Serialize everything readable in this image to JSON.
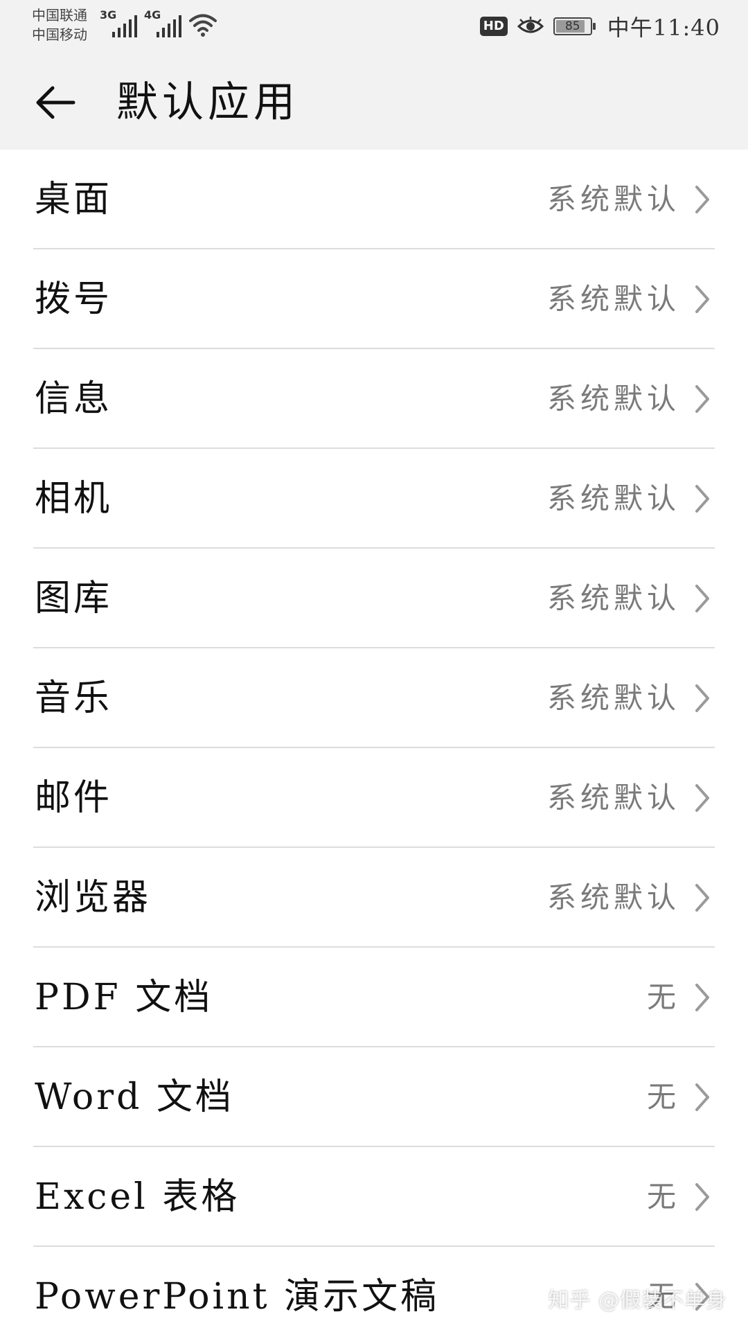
{
  "status_bar": {
    "carrier_1": "中国联通",
    "carrier_2": "中国移动",
    "network_1": "3G",
    "network_2": "4G",
    "hd_badge": "HD",
    "battery_percent": "85",
    "battery_level": 0.85,
    "time": "中午11:40",
    "icons": [
      "signal-3g-icon",
      "signal-4g-icon",
      "wifi-icon",
      "hd-icon",
      "eye-icon",
      "battery-icon"
    ]
  },
  "header": {
    "title": "默认应用",
    "back_icon": "arrow-left-icon"
  },
  "settings": {
    "items": [
      {
        "label": "桌面",
        "value": "系统默认"
      },
      {
        "label": "拨号",
        "value": "系统默认"
      },
      {
        "label": "信息",
        "value": "系统默认"
      },
      {
        "label": "相机",
        "value": "系统默认"
      },
      {
        "label": "图库",
        "value": "系统默认"
      },
      {
        "label": "音乐",
        "value": "系统默认"
      },
      {
        "label": "邮件",
        "value": "系统默认"
      },
      {
        "label": "浏览器",
        "value": "系统默认"
      },
      {
        "label": "PDF 文档",
        "value": "无"
      },
      {
        "label": "Word 文档",
        "value": "无"
      },
      {
        "label": "Excel 表格",
        "value": "无"
      },
      {
        "label": "PowerPoint 演示文稿",
        "value": "无"
      }
    ]
  },
  "watermark": "知乎 @假装不单身",
  "colors": {
    "header_bg": "#f2f2f2",
    "divider": "#dcdcdc",
    "secondary_text": "#7a7a7a"
  }
}
